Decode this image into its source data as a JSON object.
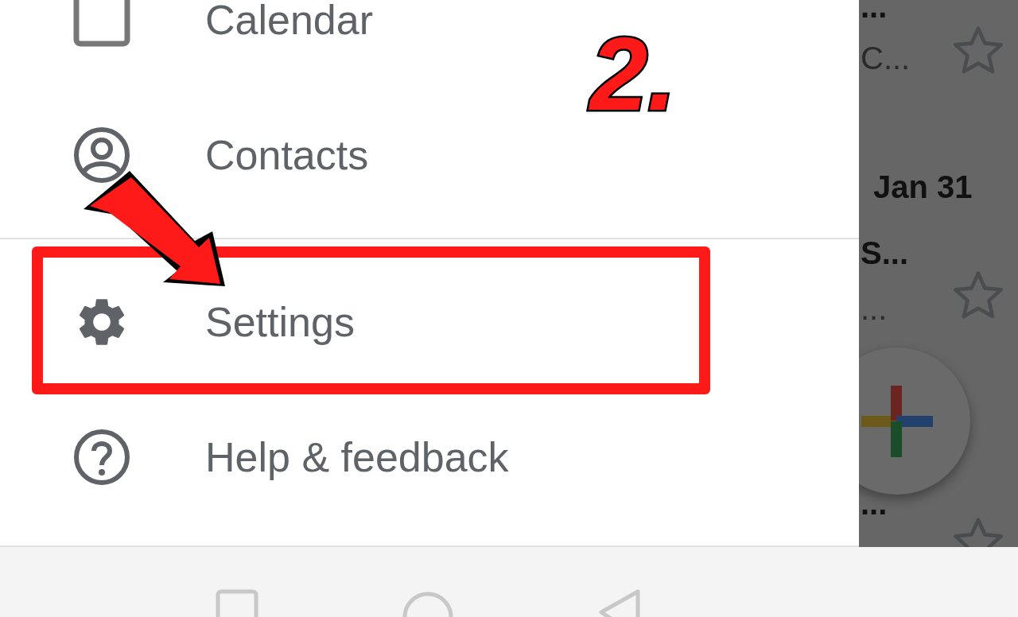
{
  "drawer": {
    "items": [
      {
        "kind": "calendar",
        "label": "Calendar",
        "highlighted": false
      },
      {
        "kind": "contacts",
        "label": "Contacts",
        "highlighted": false
      },
      {
        "kind": "divider"
      },
      {
        "kind": "settings",
        "label": "Settings",
        "highlighted": true
      },
      {
        "kind": "help",
        "label": "Help & feedback",
        "highlighted": false
      }
    ]
  },
  "annotation": {
    "step": "2."
  },
  "mail_list": {
    "fragments": [
      {
        "text": "...",
        "bold": true
      },
      {
        "text": "C...",
        "bold": false
      },
      {
        "text": "Jan 31",
        "bold": true
      },
      {
        "text": "S...",
        "bold": true
      },
      {
        "text": "...",
        "bold": false
      },
      {
        "text": "...",
        "bold": true
      }
    ]
  }
}
